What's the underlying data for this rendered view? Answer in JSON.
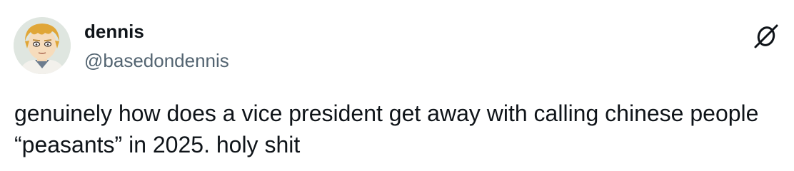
{
  "tweet": {
    "author": {
      "display_name": "dennis",
      "handle": "@basedondennis",
      "avatar_icon": "anime-character-avatar"
    },
    "text": "genuinely how does a vice president get away with calling chinese people “peasants” in 2025. holy shit",
    "brand_icon": "x-logo-icon"
  },
  "colors": {
    "text_primary": "#0f1419",
    "text_secondary": "#536471",
    "background": "#ffffff"
  }
}
